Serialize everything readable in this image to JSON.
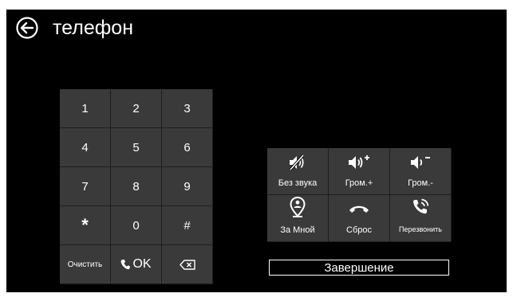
{
  "header": {
    "title": "телефон",
    "back_icon": "arrow-left-circle-icon"
  },
  "keypad": {
    "rows": [
      [
        "1",
        "2",
        "3"
      ],
      [
        "4",
        "5",
        "6"
      ],
      [
        "7",
        "8",
        "9"
      ],
      [
        "*",
        "0",
        "#"
      ]
    ],
    "clear_label": "Очистить",
    "ok_label": "OK",
    "ok_icon": "phone-icon",
    "backspace_icon": "backspace-icon"
  },
  "controls": {
    "mute_label": "Без звука",
    "vol_up_label": "Гром.+",
    "vol_down_label": "Гром.-",
    "follow_label": "За Мной",
    "reset_label": "Сброс",
    "callback_label": "Перезвонить"
  },
  "status": "Завершение",
  "colors": {
    "background": "#000000",
    "key": "#3a3a3a",
    "panel": "#1e1e1e",
    "text": "#ffffff"
  }
}
